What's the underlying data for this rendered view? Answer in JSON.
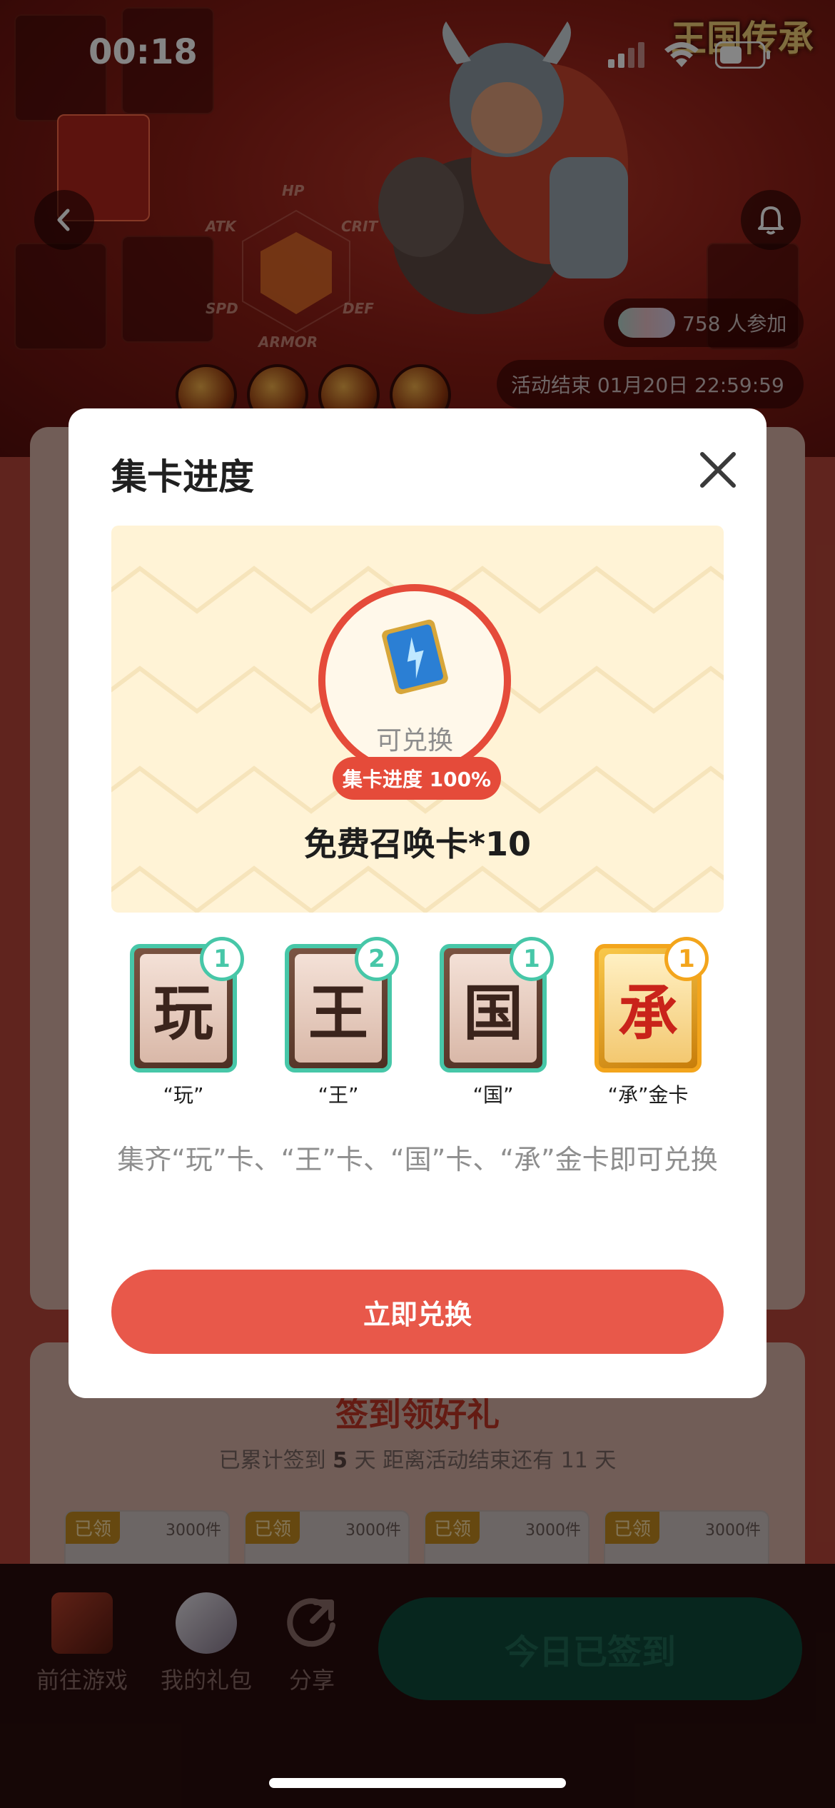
{
  "status_bar": {
    "time": "00:18"
  },
  "hero": {
    "logo": "王国传承",
    "stats": [
      "HP",
      "CRIT",
      "DEF",
      "ARMOR",
      "SPD",
      "ATK"
    ],
    "participants": "758 人参加",
    "end_time": "活动结束 01月20日 22:59:59"
  },
  "signin": {
    "title": "签到领好礼",
    "subtitle_prefix": "已累计签到",
    "days": "5",
    "subtitle_suffix": "天   距离活动结束还有 11 天",
    "rewards": [
      {
        "tag": "已领",
        "count": "3000件"
      },
      {
        "tag": "已领",
        "count": "3000件"
      },
      {
        "tag": "已领",
        "count": "3000件"
      },
      {
        "tag": "已领",
        "count": "3000件"
      }
    ]
  },
  "bottom_bar": {
    "game": "前往游戏",
    "gifts": "我的礼包",
    "share": "分享",
    "checkin": "今日已签到"
  },
  "modal": {
    "title": "集卡进度",
    "ring_text": "可兑换",
    "progress": "集卡进度 100%",
    "reward_name": "免费召唤卡*10",
    "cards": [
      {
        "glyph": "玩",
        "count": "1",
        "label": "“玩”"
      },
      {
        "glyph": "王",
        "count": "2",
        "label": "“王”"
      },
      {
        "glyph": "国",
        "count": "1",
        "label": "“国”"
      },
      {
        "glyph": "承",
        "count": "1",
        "label": "“承”金卡"
      }
    ],
    "hint": "集齐“玩”卡、“王”卡、“国”卡、“承”金卡即可兑换",
    "redeem": "立即兑换"
  },
  "colors": {
    "accent": "#e8584a",
    "teal": "#47c7a8",
    "gold": "#f3a51c"
  }
}
